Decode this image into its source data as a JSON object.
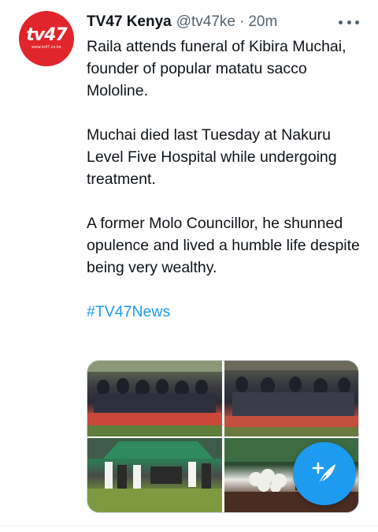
{
  "tweet": {
    "author_name": "TV47 Kenya",
    "handle": "@tv47ke",
    "separator": "·",
    "time": "20m",
    "avatar": {
      "logo_text": "tv47",
      "logo_subtext": "www.tv47.co.ke",
      "color": "#e0262b"
    },
    "paragraphs": [
      "Raila attends funeral of Kibira Muchai, founder of popular matatu sacco Mololine.",
      "Muchai died last Tuesday at Nakuru Level Five Hospital while undergoing treatment.",
      "A former Molo Councillor, he shunned opulence and lived a humble life despite being very wealthy."
    ],
    "hashtag": "#TV47News",
    "media_count": 4
  },
  "colors": {
    "link": "#1d9bf0",
    "secondary_text": "#536471",
    "fab": "#1d9bf0"
  },
  "icons": {
    "more": "more-horizontal-icon",
    "compose": "compose-tweet-icon"
  }
}
